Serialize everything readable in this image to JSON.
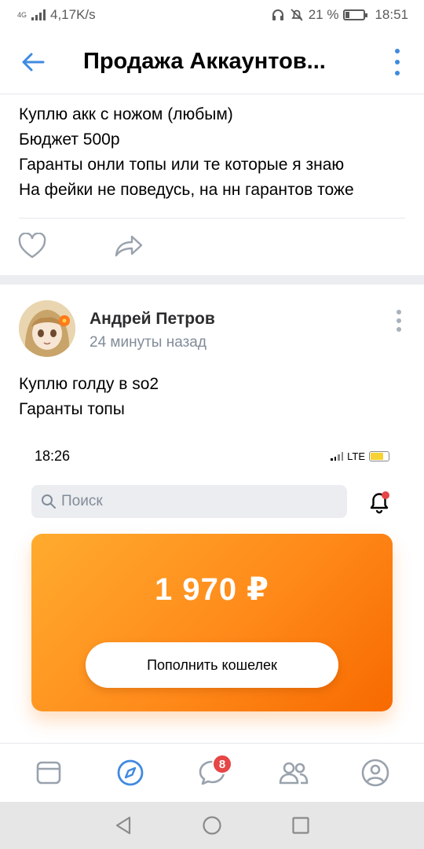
{
  "status_bar": {
    "network_type": "4G",
    "speed": "4,17K/s",
    "battery": "21 %",
    "time": "18:51"
  },
  "header": {
    "title": "Продажа Аккаунтов..."
  },
  "post1": {
    "lines": [
      "Куплю акк с ножом (любым)",
      "Бюджет 500р",
      "Гаранты онли топы или те которые я знаю",
      "На фейки не поведусь, на нн гарантов тоже"
    ]
  },
  "post2": {
    "author": "Андрей Петров",
    "time": "24 минуты назад",
    "lines": [
      "Куплю голду в so2",
      "Гаранты топы"
    ]
  },
  "embed": {
    "time": "18:26",
    "network": "LTE",
    "search_placeholder": "Поиск",
    "balance": "1 970 ₽",
    "topup_label": "Пополнить кошелек"
  },
  "bottom_nav": {
    "messages_badge": "8"
  },
  "colors": {
    "accent": "#3f8ae0",
    "wallet_orange": "#ff8a1a",
    "badge_red": "#e64646"
  }
}
